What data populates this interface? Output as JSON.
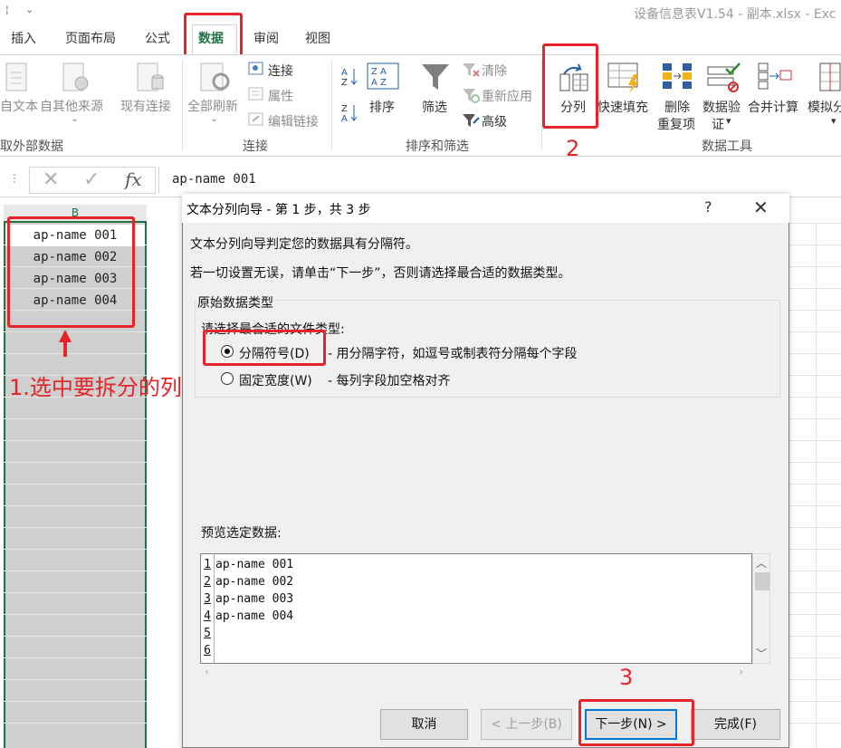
{
  "window": {
    "doc_title": "设备信息表V1.54 - 副本.xlsx - Exc"
  },
  "tabs": [
    {
      "label": "插入"
    },
    {
      "label": "页面布局"
    },
    {
      "label": "公式"
    },
    {
      "label": "数据"
    },
    {
      "label": "审阅"
    },
    {
      "label": "视图"
    }
  ],
  "ribbon": {
    "get_external": {
      "from_text": "自文本",
      "from_other": "自其他来源",
      "existing": "现有连接",
      "group_label": "取外部数据"
    },
    "connections": {
      "refresh_all": "全部刷新",
      "connections": "连接",
      "properties": "属性",
      "edit_links": "编辑链接",
      "group_label": "连接"
    },
    "sort_filter": {
      "sort": "排序",
      "filter": "筛选",
      "clear": "清除",
      "reapply": "重新应用",
      "advanced": "高级",
      "group_label": "排序和筛选"
    },
    "data_tools": {
      "text_to_columns": "分列",
      "flash_fill": "快速填充",
      "remove_dup_1": "删除",
      "remove_dup_2": "重复项",
      "validation_1": "数据验",
      "validation_2": "证",
      "consolidate": "合并计算",
      "whatif_1": "模拟分",
      "group_label": "数据工具"
    }
  },
  "formula_bar": {
    "fx": "fx",
    "value": "ap-name 001"
  },
  "sheet": {
    "column_b": "B",
    "cells": [
      "ap-name 001",
      "ap-name 002",
      "ap-name 003",
      "ap-name 004"
    ]
  },
  "annotations": {
    "step1": "1.选中要拆分的列",
    "step2": "2",
    "step3": "3"
  },
  "dialog": {
    "title": "文本分列向导 - 第 1 步，共 3 步",
    "help": "?",
    "close": "✕",
    "intro1": "文本分列向导判定您的数据具有分隔符。",
    "intro2": "若一切设置无误，请单击“下一步”，否则请选择最合适的数据类型。",
    "group_title": "原始数据类型",
    "choose_label": "请选择最合适的文件类型:",
    "option_delimited": "分隔符号(D)",
    "option_delimited_desc": "- 用分隔字符，如逗号或制表符分隔每个字段",
    "option_fixed": "固定宽度(W)",
    "option_fixed_desc": "- 每列字段加空格对齐",
    "preview_label": "预览选定数据:",
    "preview_rows": [
      {
        "num": "1",
        "text": "ap-name 001"
      },
      {
        "num": "2",
        "text": "ap-name 002"
      },
      {
        "num": "3",
        "text": "ap-name 003"
      },
      {
        "num": "4",
        "text": "ap-name 004"
      },
      {
        "num": "5",
        "text": ""
      },
      {
        "num": "6",
        "text": ""
      }
    ],
    "buttons": {
      "cancel": "取消",
      "back": "< 上一步(B)",
      "next": "下一步(N) >",
      "finish": "完成(F)"
    }
  },
  "colors": {
    "accent_green": "#217346",
    "annotation_red": "#e4262a",
    "default_button_border": "#0078d7"
  }
}
